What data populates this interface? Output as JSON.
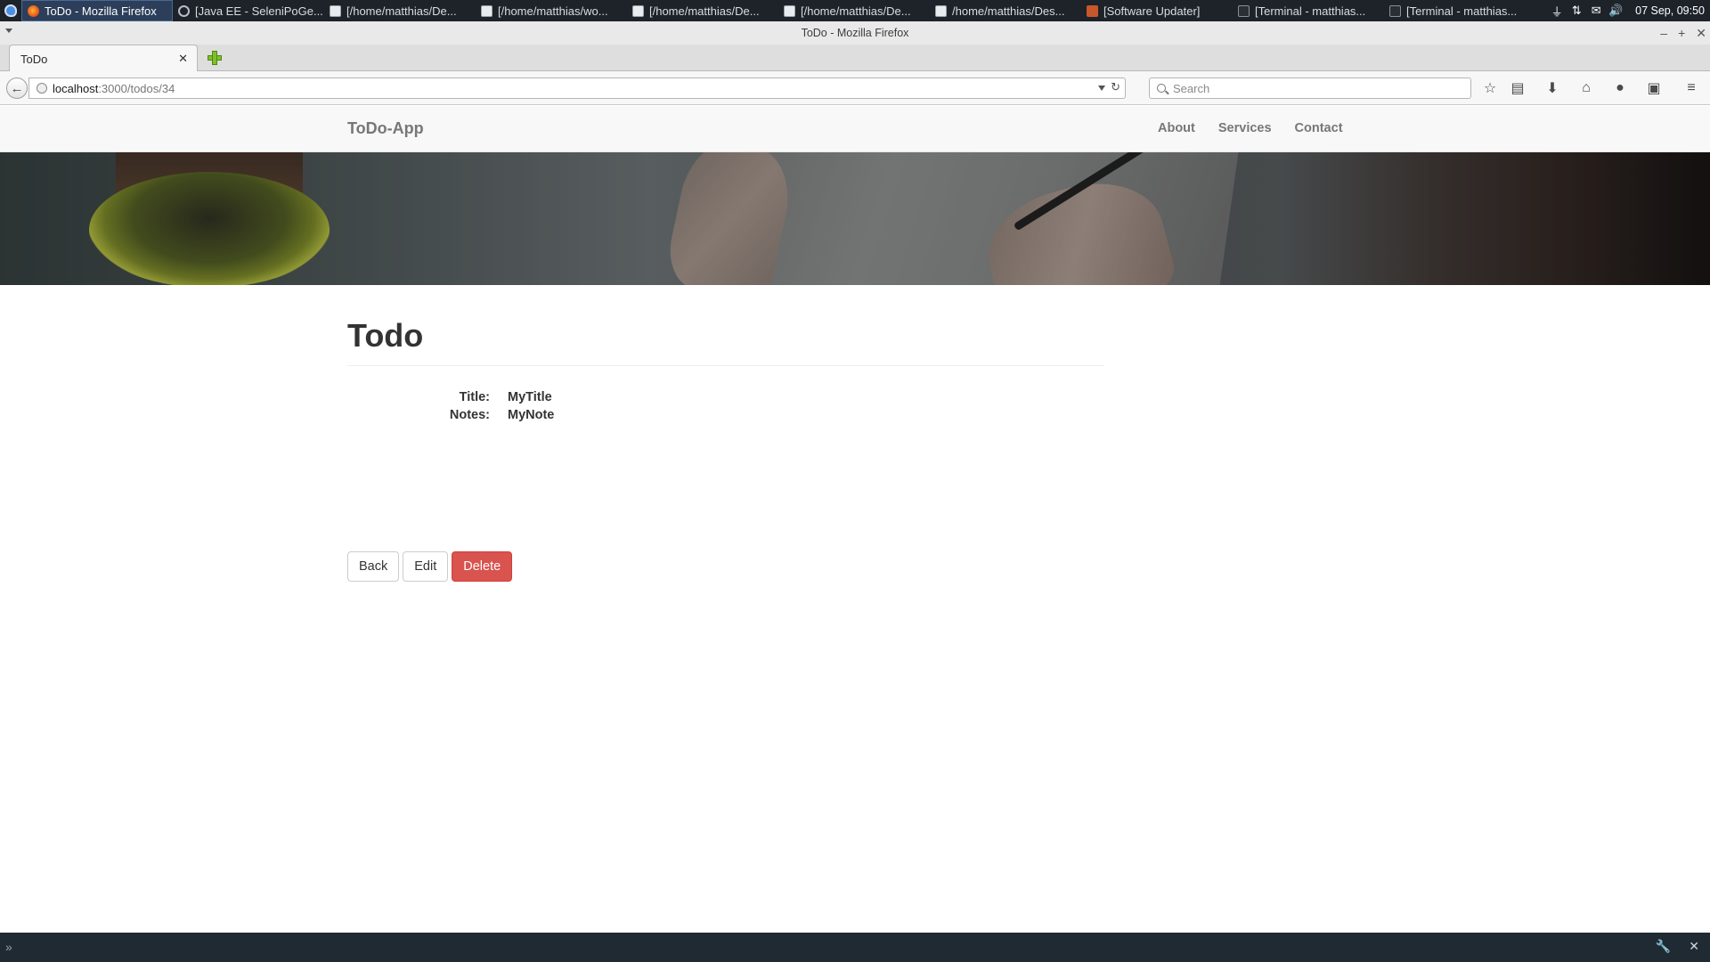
{
  "os_panel": {
    "tasks": [
      {
        "label": "ToDo - Mozilla Firefox",
        "icon": "firefox-icon",
        "active": true
      },
      {
        "label": "[Java EE - SeleniPoGe...",
        "icon": "gear-icon"
      },
      {
        "label": "[/home/matthias/De...",
        "icon": "text-editor-icon"
      },
      {
        "label": "[/home/matthias/wo...",
        "icon": "text-editor-icon"
      },
      {
        "label": "[/home/matthias/De...",
        "icon": "text-editor-icon"
      },
      {
        "label": "[/home/matthias/De...",
        "icon": "text-editor-icon"
      },
      {
        "label": "/home/matthias/Des...",
        "icon": "text-editor-icon"
      },
      {
        "label": "[Software Updater]",
        "icon": "software-updater-icon"
      },
      {
        "label": "[Terminal - matthias...",
        "icon": "terminal-icon"
      },
      {
        "label": "[Terminal - matthias...",
        "icon": "terminal-icon"
      }
    ],
    "clock": "07 Sep, 09:50"
  },
  "firefox": {
    "window_title": "ToDo - Mozilla Firefox",
    "tab_label": "ToDo",
    "url_host": "localhost",
    "url_path": ":3000/todos/34",
    "search_placeholder": "Search"
  },
  "site": {
    "brand": "ToDo-App",
    "nav": [
      "About",
      "Services",
      "Contact"
    ]
  },
  "todo": {
    "heading": "Todo",
    "fields": [
      {
        "label": "Title:",
        "value": "MyTitle"
      },
      {
        "label": "Notes:",
        "value": "MyNote"
      }
    ],
    "buttons": {
      "back": "Back",
      "edit": "Edit",
      "delete": "Delete"
    }
  },
  "colors": {
    "delete_button": "#d9534f",
    "navbar_bg": "#f8f8f8",
    "os_panel_bg": "#1d2329"
  }
}
